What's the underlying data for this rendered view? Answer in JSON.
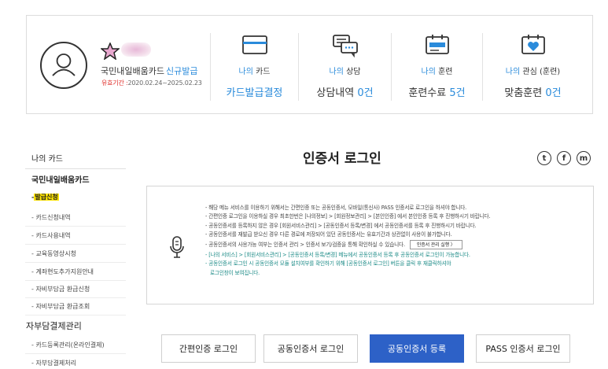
{
  "user_card": {
    "card_name": "국민내일배움카드",
    "card_status": "신규발급",
    "term_label": "유효기간 :",
    "term_value": "2020.02.24~2025.02.23"
  },
  "stats": [
    {
      "icon": "card-icon",
      "label_my": "나의",
      "label_rest": "카드",
      "value_text": "카드발급결정",
      "value_count": ""
    },
    {
      "icon": "consult-icon",
      "label_my": "나의",
      "label_rest": "상담",
      "value_text": "상담내역",
      "value_count": "0건"
    },
    {
      "icon": "training-icon",
      "label_my": "나의",
      "label_rest": "훈련",
      "value_text": "훈련수료",
      "value_count": "5건"
    },
    {
      "icon": "heart-icon",
      "label_my": "나의",
      "label_rest": "관심 (훈련)",
      "value_text": "맞춤훈련",
      "value_count": "0건"
    }
  ],
  "sidebar": {
    "title": "나의 카드",
    "section": "국민내일배움카드",
    "items": [
      {
        "label": "발급신청",
        "active": true
      },
      {
        "label": "카드신청내역"
      },
      {
        "label": "카드사용내역"
      },
      {
        "label": "교육동영상시청"
      },
      {
        "label": "계좌현도추가지원안내"
      },
      {
        "label": "자비부담금 환급신청"
      },
      {
        "label": "자비부담금 환급조회"
      }
    ],
    "section2": "자부담결제관리",
    "items2": [
      {
        "label": "카드등록관리(온라인결제)"
      },
      {
        "label": "자부담결제처리"
      }
    ]
  },
  "main": {
    "title": "인증서 로그인",
    "notes": [
      "해당 메뉴 서비스를 이용하기 위해서는 간편인증 또는 공동인증서, 모바일(통신사) PASS 인증서로 로그인을 하셔야 합니다.",
      "간편인증 로그인을 이용하실 경우 최초한번은 [나의정보] > [회원정보관리] > [본인인증] 에서 본인인증 등록 후 진행하시기 바랍니다.",
      "공동인증서를 등록하지 않은 경우 [회원서비스관리] > [공동인증서 등록/변경] 에서 공동인증서를 등록 후 진행하시기 바랍니다.",
      "공동인증서를 재발급 받으신 경우 다른 경로에 저장되어 있던 공동인증서는 유효기간과 상관없이 사용이 불가합니다.",
      "공동인증서의 사용가능 여부는 인증서 관리 > 인증서 보기/검증을 통해 확인하실 수 있습니다."
    ],
    "verify_button": "인증서 관리 실행 〉",
    "teal_notes": [
      "[나의 서비스] > [회원서비스관리] > [공동인증서 등록/변경] 메뉴에서 공동인증서 등록 후 공동인증서 로그인이 가능합니다.",
      "공동인증서 로그인 시 공동인증서 모듈 설치여부를 확인하기 위해 [공동인증서 로그인] 버튼을 클릭 후 재클릭하셔야",
      "로그인창이 보여집니다."
    ],
    "tabs": [
      "간편인증 로그인",
      "공동인증서 로그인",
      "공동인증서 등록",
      "PASS 인증서 로그인"
    ],
    "active_tab": 2
  },
  "share": {
    "twitter": "t",
    "facebook": "f",
    "message": "m"
  },
  "colors": {
    "accent": "#2a8bdb",
    "tab_active": "#2d61c7",
    "teal": "#1a8a86",
    "highlight": "#ffe400",
    "alert": "#e0302c"
  }
}
